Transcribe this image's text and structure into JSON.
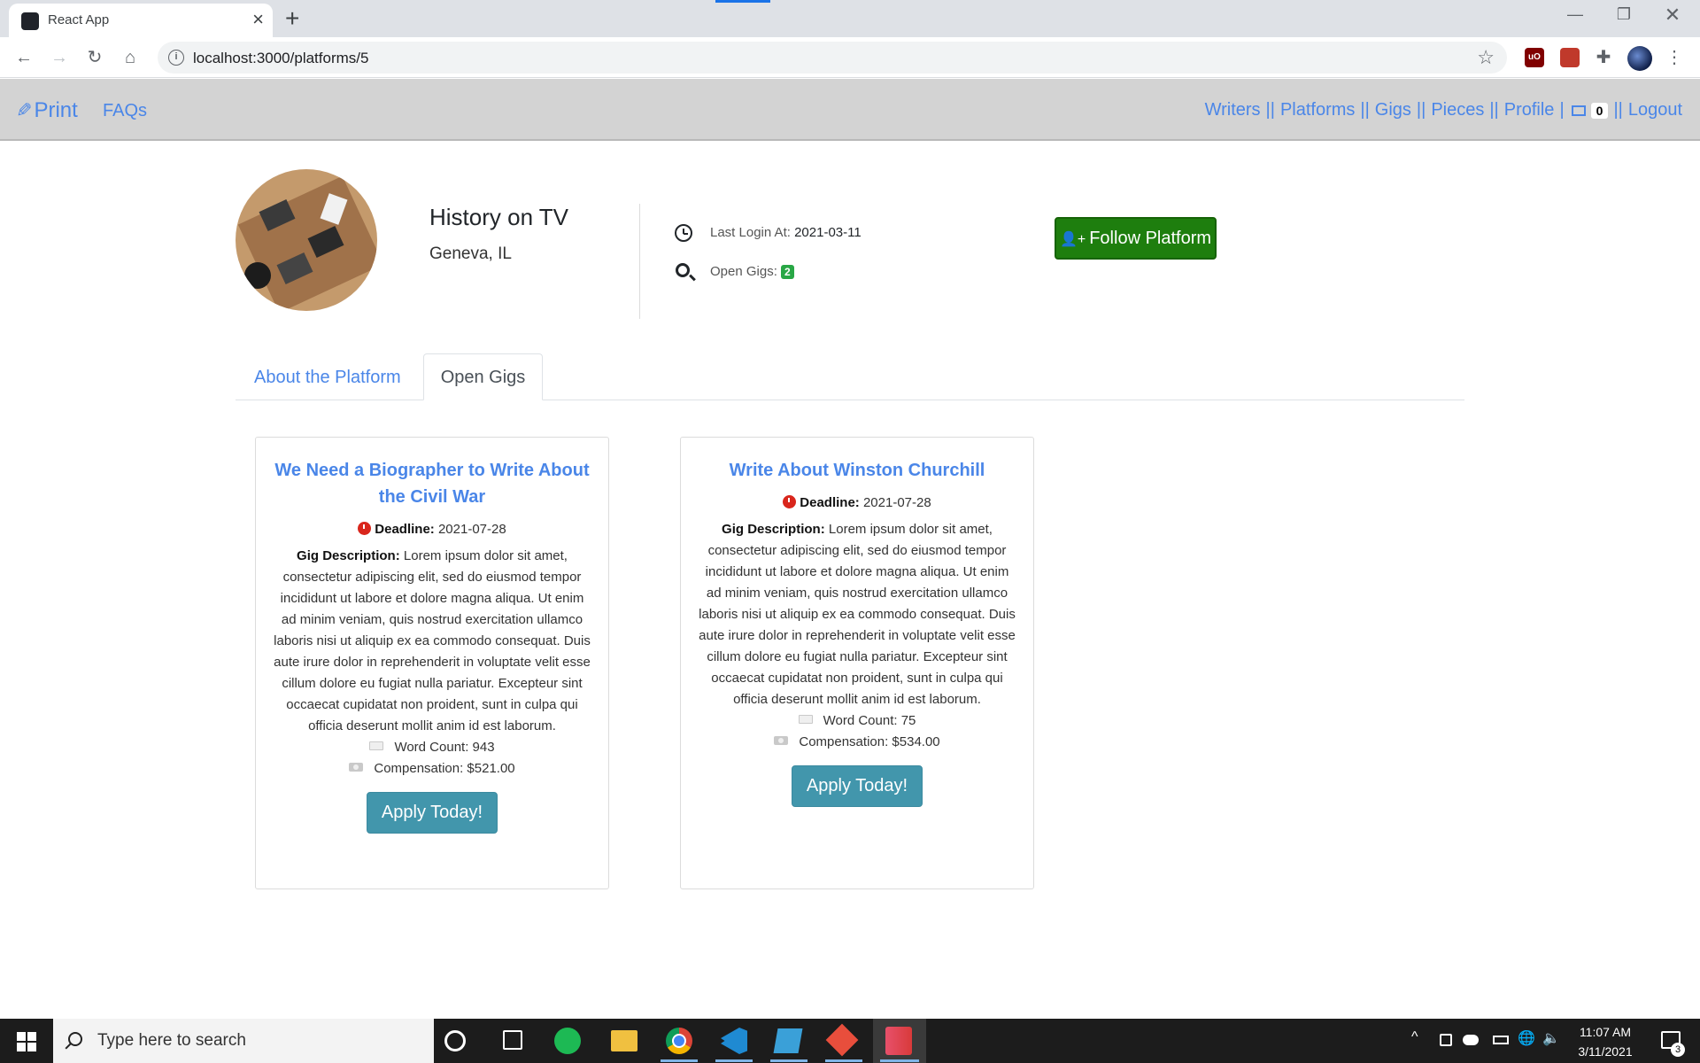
{
  "browser": {
    "tab_title": "React App",
    "tab_close": "×",
    "new_tab": "+",
    "url": "localhost:3000/platforms/5",
    "win_min": "—",
    "win_max": "❐",
    "win_close": "✕",
    "back": "←",
    "forward": "→",
    "reload": "↻",
    "home": "⌂",
    "star": "☆",
    "ext_ublock_label": "uO"
  },
  "navbar": {
    "brand": "Print",
    "faqs": "FAQs",
    "links": [
      "Writers",
      "Platforms",
      "Gigs",
      "Pieces",
      "Profile"
    ],
    "separator": "||",
    "single_separator": "|",
    "messages_count": "0",
    "logout": "Logout"
  },
  "platform": {
    "name": "History on TV",
    "location": "Geneva, IL",
    "last_login_label": "Last Login At:",
    "last_login_value": "2021-03-11",
    "open_gigs_label": "Open Gigs:",
    "open_gigs_count": "2",
    "follow_label": "Follow Platform"
  },
  "tabs": {
    "about": "About the Platform",
    "open_gigs": "Open Gigs",
    "active": "open_gigs"
  },
  "gigs": [
    {
      "title": "We Need a Biographer to Write About the Civil War",
      "deadline_label": "Deadline:",
      "deadline": "2021-07-28",
      "desc_label": "Gig Description:",
      "description": "Lorem ipsum dolor sit amet, consectetur adipiscing elit, sed do eiusmod tempor incididunt ut labore et dolore magna aliqua. Ut enim ad minim veniam, quis nostrud exercitation ullamco laboris nisi ut aliquip ex ea commodo consequat. Duis aute irure dolor in reprehenderit in voluptate velit esse cillum dolore eu fugiat nulla pariatur. Excepteur sint occaecat cupidatat non proident, sunt in culpa qui officia deserunt mollit anim id est laborum.",
      "word_count": "Word Count: 943",
      "compensation": "Compensation: $521.00",
      "apply_label": "Apply Today!"
    },
    {
      "title": "Write About Winston Churchill",
      "deadline_label": "Deadline:",
      "deadline": "2021-07-28",
      "desc_label": "Gig Description:",
      "description": "Lorem ipsum dolor sit amet, consectetur adipiscing elit, sed do eiusmod tempor incididunt ut labore et dolore magna aliqua. Ut enim ad minim veniam, quis nostrud exercitation ullamco laboris nisi ut aliquip ex ea commodo consequat. Duis aute irure dolor in reprehenderit in voluptate velit esse cillum dolore eu fugiat nulla pariatur. Excepteur sint occaecat cupidatat non proident, sunt in culpa qui officia deserunt mollit anim id est laborum.",
      "word_count": "Word Count: 75",
      "compensation": "Compensation: $534.00",
      "apply_label": "Apply Today!"
    }
  ],
  "taskbar": {
    "search_placeholder": "Type here to search",
    "time": "11:07 AM",
    "date": "3/11/2021",
    "notification_count": "3",
    "tray_chevron": "^",
    "tray_volume": "🔈",
    "tray_globe": "🌐"
  },
  "colors": {
    "link": "#4a86e8",
    "follow_button": "#1e7e0e",
    "apply_button": "#4296ac",
    "navbar_bg": "#d3d3d3",
    "deadline_icon": "#d9261c",
    "gig_badge": "#28a745"
  }
}
